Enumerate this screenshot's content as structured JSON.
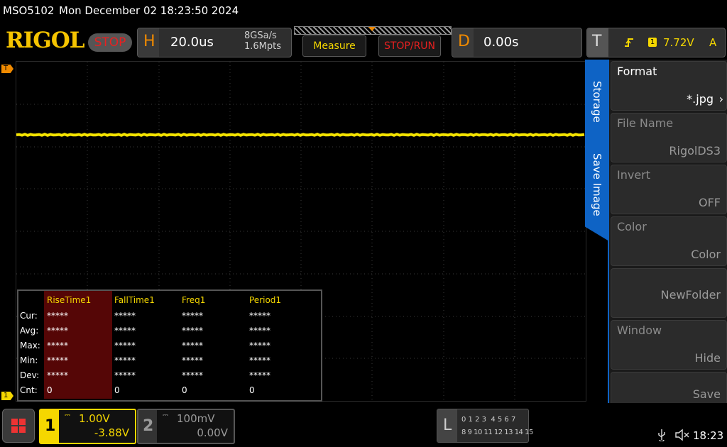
{
  "status": {
    "model": "MSO5102",
    "datetime": "Mon December 02 18:23:50 2024"
  },
  "top": {
    "logo": "RIGOL",
    "run_state": "STOP",
    "horizontal": {
      "letter": "H",
      "timebase": "20.0us",
      "sample_rate": "8GSa/s",
      "memory_depth": "1.6Mpts"
    },
    "measure_label": "Measure",
    "stoprun_label": "STOP/RUN",
    "delay": {
      "letter": "D",
      "value": "0.00s"
    },
    "trigger": {
      "letter": "T",
      "channel": "1",
      "level": "7.72V",
      "mode": "A"
    }
  },
  "markers": {
    "trigger_left": "T",
    "trigger_top": "T",
    "ch1_ground": "1"
  },
  "side_menu": {
    "tabs": [
      "Storage",
      "Save Image"
    ],
    "items": [
      {
        "title": "Format",
        "value": "*.jpg"
      },
      {
        "title": "File Name",
        "value": "RigolDS3"
      },
      {
        "title": "Invert",
        "value": "OFF"
      },
      {
        "title": "Color",
        "value": "Color"
      },
      {
        "title": "",
        "value": "NewFolder"
      },
      {
        "title": "Window",
        "value": "Hide"
      },
      {
        "title": "",
        "value": "Save"
      }
    ]
  },
  "measurements": {
    "headers": [
      "RiseTime1",
      "FallTime1",
      "Freq1",
      "Period1"
    ],
    "row_labels": [
      "Cur:",
      "Avg:",
      "Max:",
      "Min:",
      "Dev:",
      "Cnt:"
    ],
    "rows": [
      [
        "*****",
        "*****",
        "*****",
        "*****"
      ],
      [
        "*****",
        "*****",
        "*****",
        "*****"
      ],
      [
        "*****",
        "*****",
        "*****",
        "*****"
      ],
      [
        "*****",
        "*****",
        "*****",
        "*****"
      ],
      [
        "*****",
        "*****",
        "*****",
        "*****"
      ],
      [
        "0",
        "0",
        "0",
        "0"
      ]
    ]
  },
  "channels": {
    "ch1": {
      "number": "1",
      "scale": "1.00V",
      "offset": "-3.88V",
      "color": "#f5d700"
    },
    "ch2": {
      "number": "2",
      "scale": "100mV",
      "offset": "0.00V",
      "color": "#8a8a8a"
    }
  },
  "logic": {
    "letter": "L",
    "row1": "0 1 2 3  4 5 6 7",
    "row2": "8 9 10 11 12 13 14 15"
  },
  "system": {
    "time": "18:23",
    "usb_icon": "usb-icon",
    "sound_icon": "mute-icon"
  },
  "colors": {
    "trace": "#f5e400",
    "accent": "#f08a00",
    "menu_tab": "#0e63c5",
    "stop": "#e82020"
  }
}
